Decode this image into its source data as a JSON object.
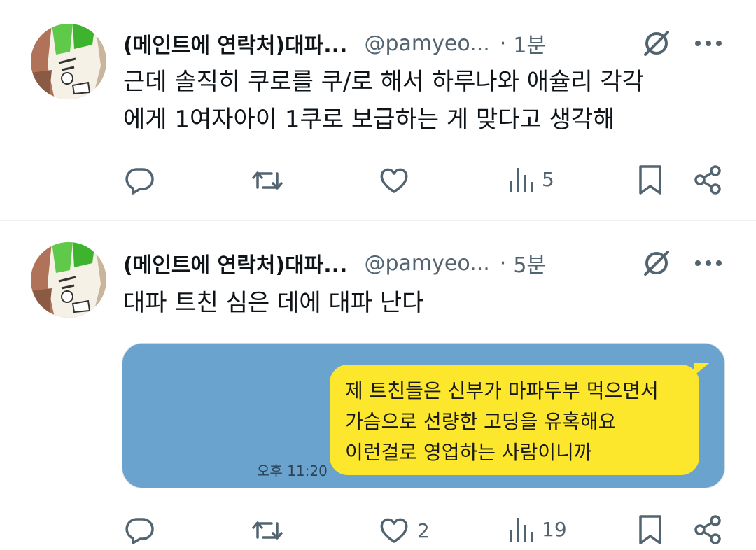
{
  "tweets": [
    {
      "author_name": "(메인트에 연락처)대파...",
      "handle": "@pamyeo...",
      "separator": "·",
      "time": "1분",
      "lines": [
        "근데 솔직히 쿠로를 쿠/로 해서 하루나와 애슐리 각각",
        "에게 1여자아이 1쿠로 보급하는 게 맞다고 생각해"
      ],
      "actions": {
        "replies": "",
        "retweets": "",
        "likes": "",
        "views": "5"
      }
    },
    {
      "author_name": "(메인트에 연락처)대파...",
      "handle": "@pamyeo...",
      "separator": "·",
      "time": "5분",
      "lines": [
        "대파 트친 심은 데에 대파 난다"
      ],
      "media": {
        "message_lines": [
          "제 트친들은 신부가 마파두부 먹으면서",
          "가슴으로 선량한 고딩을 유혹해요",
          "이런걸로 영업하는 사람이니까"
        ],
        "message_time": "오후 11:20",
        "bubble_color": "#fce72d",
        "chat_background": "#6aa3cd"
      },
      "actions": {
        "replies": "",
        "retweets": "",
        "likes": "2",
        "views": "19"
      }
    }
  ],
  "icons": {
    "reply": "reply-icon",
    "retweet": "retweet-icon",
    "like": "heart-icon",
    "views": "views-icon",
    "bookmark": "bookmark-icon",
    "share": "share-icon",
    "grok": "grok-icon",
    "more": "more-icon"
  },
  "colors": {
    "text": "#0f1419",
    "secondary": "#536471",
    "divider": "#eff3f4"
  }
}
